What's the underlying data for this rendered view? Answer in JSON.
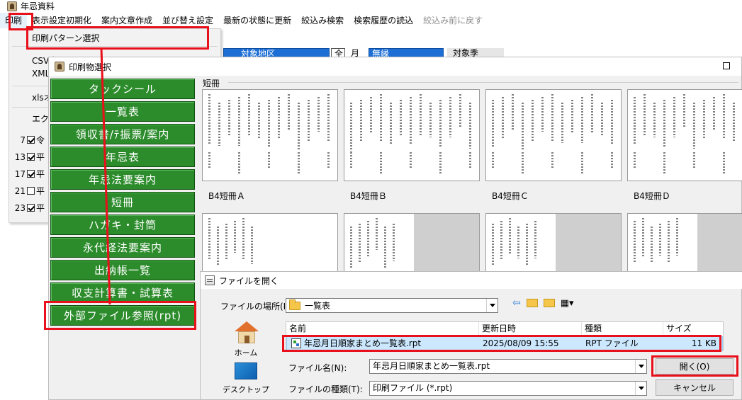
{
  "main_window": {
    "title": "年忌資料",
    "menu": [
      {
        "label": "印刷",
        "active": true
      },
      {
        "label": "表示設定初期化"
      },
      {
        "label": "案内文章作成"
      },
      {
        "label": "並び替え設定"
      },
      {
        "label": "最新の状態に更新"
      },
      {
        "label": "絞込み検索"
      },
      {
        "label": "検索履歴の読込"
      },
      {
        "label": "絞込み前に戻す",
        "disabled": true
      }
    ],
    "dropdown_items": [
      "印刷パターン選択",
      "CSV出",
      "XML",
      "xlsオ",
      "エクセ"
    ],
    "rows": [
      {
        "num": "7",
        "checked": true,
        "text": "令"
      },
      {
        "num": "13",
        "checked": true,
        "text": "平"
      },
      {
        "num": "17",
        "checked": true,
        "text": "平"
      },
      {
        "num": "21",
        "checked": false,
        "text": "平"
      },
      {
        "num": "23",
        "checked": true,
        "text": "平"
      }
    ],
    "filter_strip": {
      "region": "対象地区",
      "all_char": "全",
      "month_char": "月",
      "relation": "無縁",
      "target": "対象季"
    }
  },
  "print_window": {
    "title": "印刷物選択",
    "buttons": [
      "タックシール",
      "一覧表",
      "領収書/ﾃ振票/案内",
      "年忌表",
      "年忌法要案内",
      "短冊",
      "ハガキ・封筒",
      "永代経法要案内",
      "出納帳一覧",
      "収支計算書・試算表",
      "外部ファイル参照(rpt)"
    ],
    "group_label": "短冊",
    "thumbnails": [
      "B4短冊Ａ",
      "B4短冊Ｂ",
      "B4短冊Ｃ",
      "B4短冊Ｄ"
    ]
  },
  "file_dialog": {
    "title": "ファイルを開く",
    "location_label": "ファイルの場所(I):",
    "location_value": "一覧表",
    "places": [
      {
        "label": "ホーム",
        "icon": "home-icon"
      },
      {
        "label": "デスクトップ",
        "icon": "desktop-icon"
      }
    ],
    "columns": [
      "名前",
      "更新日時",
      "種類",
      "サイズ"
    ],
    "files": [
      {
        "name": "年忌月日順家まとめ一覧表.rpt",
        "modified": "2025/08/09 15:55",
        "type": "RPT ファイル",
        "size": "11 KB"
      }
    ],
    "filename_label": "ファイル名(N):",
    "filename_value": "年忌月日順家まとめ一覧表.rpt",
    "filetype_label": "ファイルの種類(T):",
    "filetype_value": "印刷ファイル (*.rpt)",
    "open_button": "開く(O)",
    "cancel_button": "キャンセル"
  },
  "annotation_color": "#e8101a",
  "button_color": "#2c8c2c"
}
